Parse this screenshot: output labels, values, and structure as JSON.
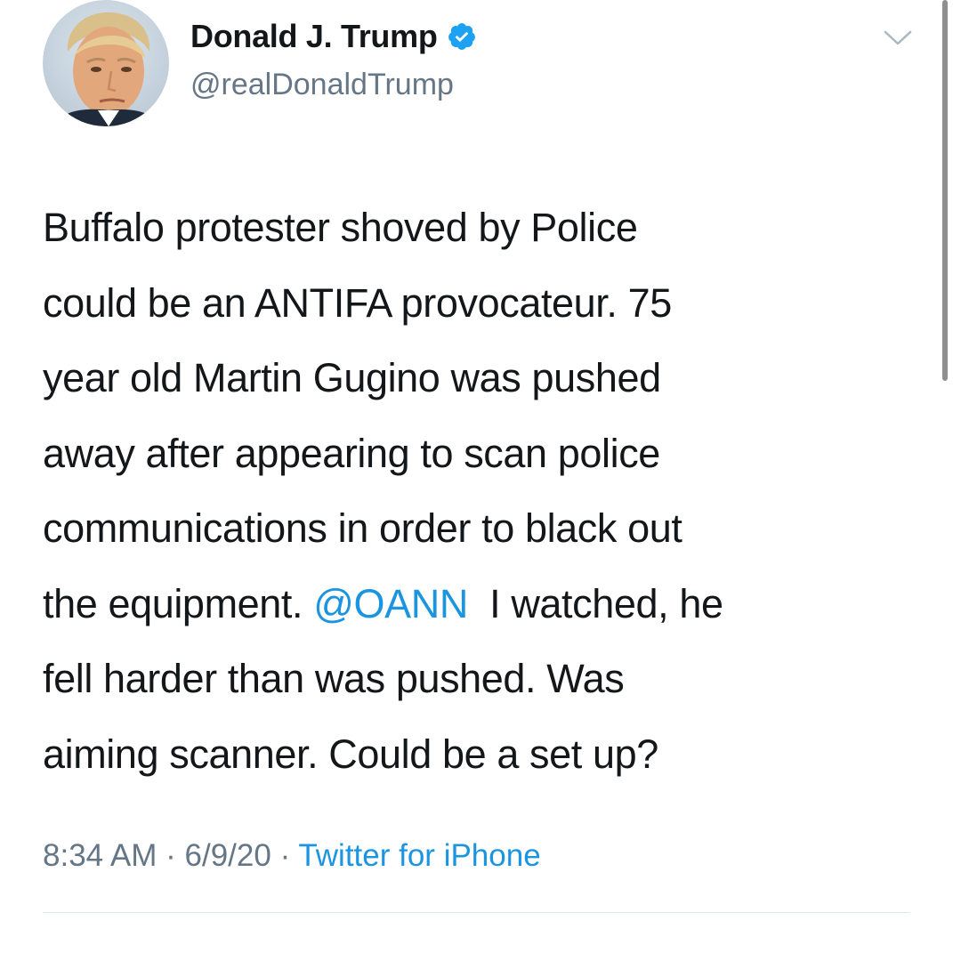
{
  "author": {
    "display_name": "Donald J. Trump",
    "handle": "@realDonaldTrump",
    "verified": true,
    "verified_color": "#1da1f2"
  },
  "tweet": {
    "lines": [
      "Buffalo protester shoved by Police",
      "could be an ANTIFA provocateur. 75",
      "year old Martin Gugino was pushed",
      "away after appearing to scan police",
      "communications in order to black out"
    ],
    "line6_before": "the equipment. ",
    "mention": "@OANN",
    "line6_after": "  I watched, he",
    "line7": "fell harder than was pushed. Was",
    "line8": "aiming scanner. Could be a set up?",
    "mention_color": "#1b95e0"
  },
  "meta": {
    "time": "8:34 AM",
    "separator": " · ",
    "date": "6/9/20",
    "source": "Twitter for iPhone"
  },
  "icons": {
    "verified": "verified-badge-icon",
    "menu": "chevron-down-icon"
  },
  "colors": {
    "text": "#14171a",
    "secondary": "#657786",
    "link": "#1b95e0"
  }
}
